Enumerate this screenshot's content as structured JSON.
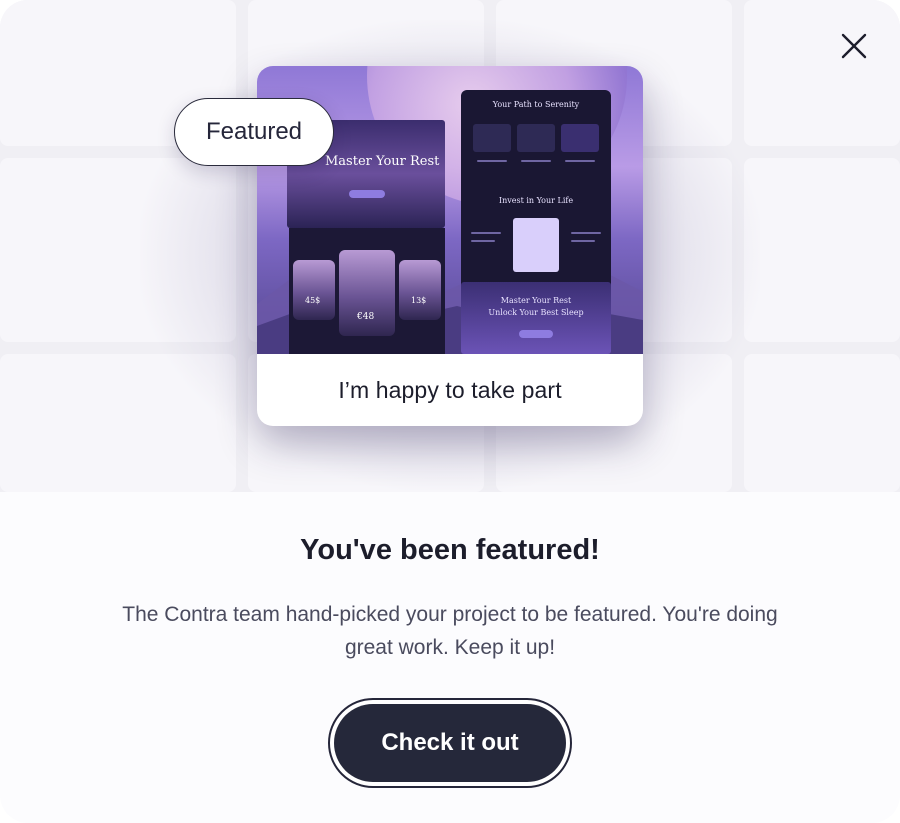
{
  "dialog": {
    "close_icon": "close-x-icon",
    "badge_label": "Featured",
    "project": {
      "caption": "I’m happy to take part",
      "thumbnail_texts": {
        "hero_heading": "Master Your Rest",
        "path_heading": "Your Path to Serenity",
        "invest_heading": "Invest in Your Life",
        "unlock_line1": "Master Your Rest",
        "unlock_line2": "Unlock Your Best Sleep",
        "price_a": "45$",
        "price_b": "€48",
        "price_c": "13$"
      }
    },
    "title": "You've been featured!",
    "message": "The Contra team hand-picked your project to be featured. You're doing great work. Keep it up!",
    "cta_label": "Check it out"
  },
  "colors": {
    "button_bg": "#25283a",
    "text_primary": "#1c1d2b",
    "text_secondary": "#4a4b5e",
    "hero_bg": "#f0eff4",
    "accent_purple": "#8e7ce0"
  }
}
